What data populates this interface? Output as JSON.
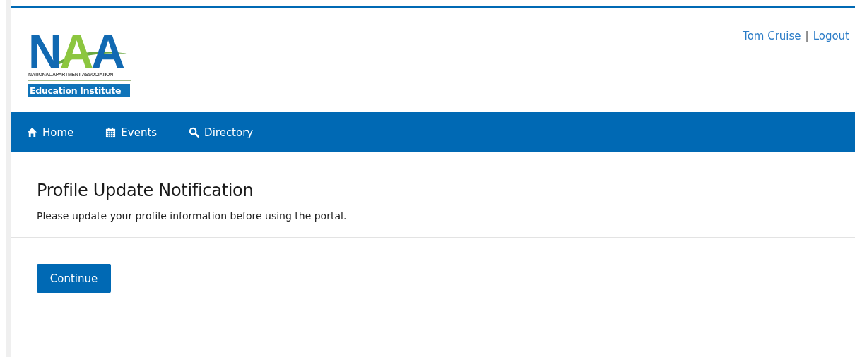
{
  "logo": {
    "letters": "NAA",
    "association": "NATIONAL APARTMENT ASSOCIATION",
    "subtitle": "Education Institute"
  },
  "user_menu": [
    {
      "label": "Tom Cruise"
    },
    {
      "label": "Logout"
    }
  ],
  "user_menu_separator": "|",
  "nav": [
    {
      "kind": "home",
      "label": "Home"
    },
    {
      "kind": "calendar",
      "label": "Events"
    },
    {
      "kind": "search",
      "label": "Directory"
    }
  ],
  "notice": {
    "title": "Profile Update Notification",
    "message": "Please update your profile information before using the portal."
  },
  "buttons": [
    {
      "label": "Continue"
    }
  ]
}
